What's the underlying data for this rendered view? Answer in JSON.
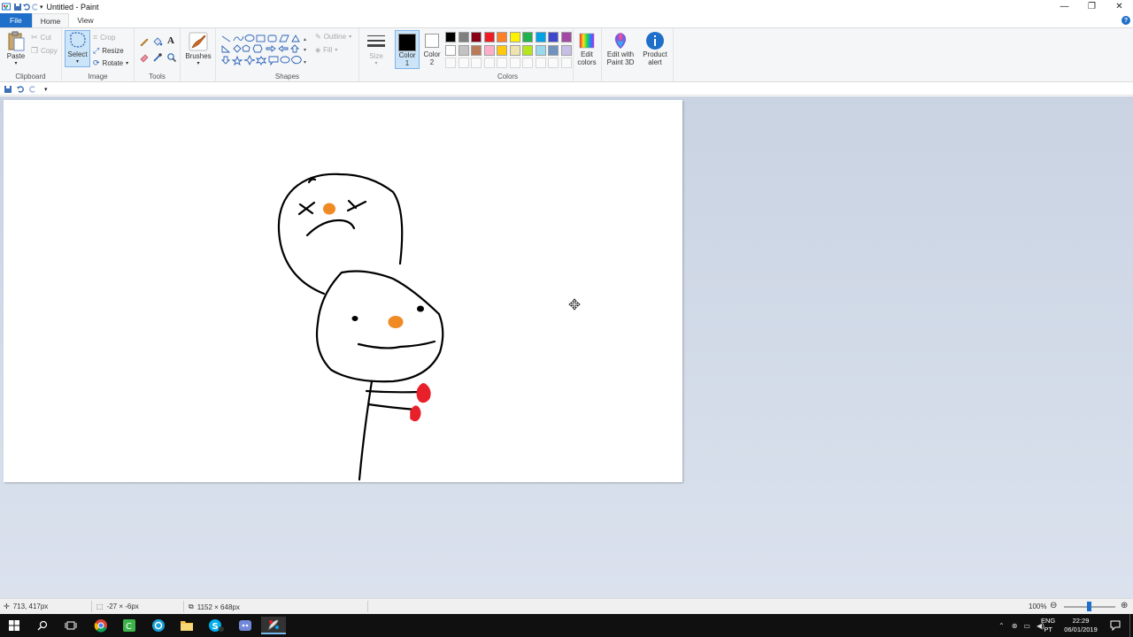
{
  "window": {
    "title": "Untitled - Paint",
    "controls": {
      "minimize": "—",
      "maximize": "❐",
      "close": "✕"
    }
  },
  "tabs": {
    "file": "File",
    "home": "Home",
    "view": "View"
  },
  "ribbon": {
    "clipboard": {
      "label": "Clipboard",
      "paste": "Paste",
      "cut": "Cut",
      "copy": "Copy"
    },
    "image": {
      "label": "Image",
      "select": "Select",
      "crop": "Crop",
      "resize": "Resize",
      "rotate": "Rotate"
    },
    "tools": {
      "label": "Tools"
    },
    "brushes": {
      "label": "Brushes"
    },
    "shapes": {
      "label": "Shapes",
      "outline": "Outline",
      "fill": "Fill"
    },
    "size": {
      "label": "Size"
    },
    "color1": {
      "label_line1": "Color",
      "label_line2": "1",
      "value": "#000000"
    },
    "color2": {
      "label_line1": "Color",
      "label_line2": "2",
      "value": "#ffffff"
    },
    "colors": {
      "label": "Colors"
    },
    "edit_colors": {
      "line1": "Edit",
      "line2": "colors"
    },
    "paint3d": {
      "line1": "Edit with",
      "line2": "Paint 3D"
    },
    "product_alert": {
      "line1": "Product",
      "line2": "alert"
    }
  },
  "palette": [
    "#000000",
    "#7f7f7f",
    "#880015",
    "#ed1c24",
    "#ff7f27",
    "#fff200",
    "#22b14c",
    "#00a2e8",
    "#3f48cc",
    "#a349a4",
    "#ffffff",
    "#c3c3c3",
    "#b97a57",
    "#ffaec9",
    "#ffc90e",
    "#efe4b0",
    "#b5e61d",
    "#99d9ea",
    "#7092be",
    "#c8bfe7"
  ],
  "statusbar": {
    "cursor_pos": "713, 417px",
    "selection_size": "-27 × -6px",
    "image_size": "1152 × 648px",
    "zoom": "100%"
  },
  "taskbar": {
    "lang_line1": "ENG",
    "lang_line2": "PT",
    "time": "22:29",
    "date": "06/01/2019"
  },
  "colors": {
    "accent": "#1e6fc9",
    "workspace": "#cdd7e6",
    "nose": "#f08a24",
    "red": "#e8202a"
  }
}
